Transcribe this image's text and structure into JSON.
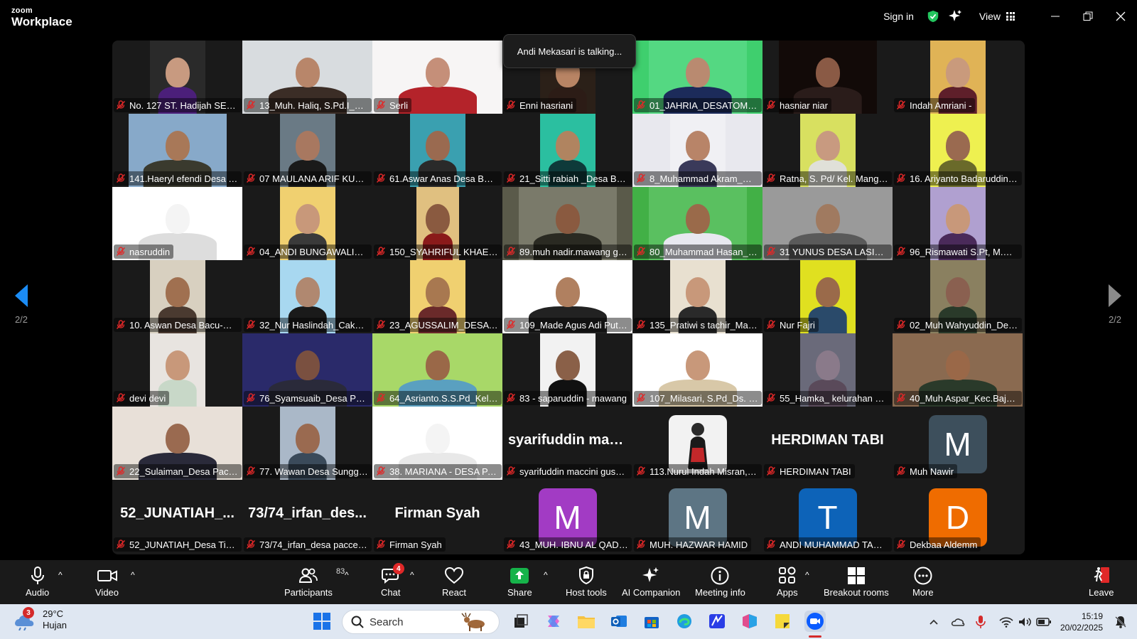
{
  "app": {
    "logo_line1": "zoom",
    "logo_line2": "Workplace",
    "sign_in": "Sign in",
    "view_label": "View"
  },
  "toast": "Andi Mekasari is talking...",
  "pager": {
    "left": "2/2",
    "right": "2/2"
  },
  "participants": [
    "No. 127 ST. Hadijah SE  K...",
    "13_Muh. Haliq, S.Pd.I_Des...",
    "Serli",
    "Enni hasriani",
    "01_JAHRIA_DESATOMPO",
    "hasniar niar",
    "Indah Amriani -",
    "141.Haeryl efendi Desa Ta...",
    "07 MAULANA ARIF KUSU...",
    "61.Aswar Anas Desa Bulo...",
    "21_Sitti rabiah _Desa Bat...",
    "8_Muhammad Akram_De...",
    "Ratna, S. Pd/ Kel. Manggal...",
    "16. Ariyanto Badaruddin, ...",
    "nasruddin",
    "04_ANDI BUNGAWALI_D...",
    "150_SYAHRIFUL KHAERU...",
    "89.muh nadir.mawang go...",
    "80_Muhammad Hasan_K...",
    "31 YUNUS DESA LASITAE...",
    "96_Rismawati S.Pt, M.P_S...",
    "10. Aswan Desa Bacu-Bac...",
    "32_Nur Haslindah_Cakke ...",
    "23_AGUSSALIM_DESA M...",
    "109_Made Agus Adi Putr...",
    "135_Pratiwi s tachir_Man...",
    "Nur Fajri",
    "02_Muh Wahyuddin_Des...",
    "devi devi",
    "76_Syamsuaib_Desa Pana...",
    "64_Asrianto.S.S.Pd_Kel.Kal...",
    "83 - saparuddin - mawang",
    "107_Milasari, S.Pd_Ds. Jal...",
    "55_Hamka_ kelurahan bo...",
    "40_Muh Aspar_Kec.Bajen...",
    "22_Sulaiman_Desa Pacce...",
    "77. Wawan Desa Sunggu...",
    "38. MARIANA - DESA PAB...",
    "syarifuddin maccini gusu...",
    "113.Nurul Indah Misran,S...",
    "HERDIMAN TABI",
    "Muh Nawir",
    "52_JUNATIAH_Desa Ting...",
    "73/74_irfan_desa paccelle...",
    "Firman Syah",
    "43_MUH. IBNU AL QADRI...",
    "MUH. HAZWAR HAMID",
    "ANDI MUHAMMAD TAUF...",
    "Dekbaa Aldemm"
  ],
  "big_names": {
    "syarifuddin": "syarifuddin  mac...",
    "herdiman": "HERDIMAN TABI",
    "junatiah": "52_JUNATIAH_...",
    "irfan": "73/74_irfan_des...",
    "firman": "Firman Syah"
  },
  "avatars": {
    "muh_nawir": {
      "letter": "M",
      "color": "#3d4f5c"
    },
    "ibnu": {
      "letter": "M",
      "color": "#a23bc4"
    },
    "hazwar": {
      "letter": "M",
      "color": "#5d7584"
    },
    "andi_tauf": {
      "letter": "T",
      "color": "#0d63b8"
    },
    "dekbaa": {
      "letter": "D",
      "color": "#ef6c00"
    }
  },
  "toolbar": {
    "audio": "Audio",
    "video": "Video",
    "participants": "Participants",
    "participants_count": "83",
    "chat": "Chat",
    "chat_badge": "4",
    "react": "React",
    "share": "Share",
    "host_tools": "Host tools",
    "ai_companion": "AI Companion",
    "meeting_info": "Meeting info",
    "apps": "Apps",
    "breakout_rooms": "Breakout rooms",
    "more": "More",
    "leave": "Leave"
  },
  "taskbar": {
    "weather_badge": "3",
    "temperature": "29°C",
    "condition": "Hujan",
    "search_placeholder": "Search",
    "time": "15:19",
    "date": "20/02/2025"
  },
  "colors": {
    "accent_blue": "#1b8cf5",
    "share_green": "#16b34a",
    "muted_red": "#e02828"
  }
}
